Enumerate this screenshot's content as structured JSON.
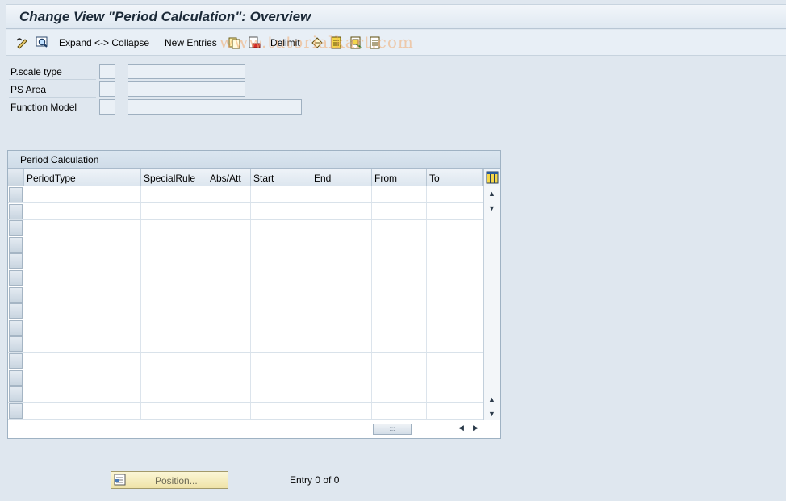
{
  "window": {
    "title": "Change View \"Period Calculation\": Overview"
  },
  "toolbar": {
    "display_change_icon": "glasses-pencil-icon",
    "other_view_icon": "magnifier-icon",
    "expand_collapse_label": "Expand <-> Collapse",
    "new_entries_label": "New Entries",
    "copy_icon": "copy-icon",
    "delete_icon": "delete-icon",
    "delimit_label": "Delimit",
    "undo_icon": "undo-icon",
    "select_all_icon": "select-all-icon",
    "select_block_icon": "select-block-icon",
    "deselect_all_icon": "deselect-all-icon",
    "watermark": "www.tutorialkart.com"
  },
  "fields": [
    {
      "label": "P.scale type",
      "value": ""
    },
    {
      "label": "PS Area",
      "value": ""
    },
    {
      "label": "Function Model",
      "value": ""
    }
  ],
  "table": {
    "title": "Period Calculation",
    "columns": [
      "PeriodType",
      "SpecialRule",
      "Abs/Att",
      "Start",
      "End",
      "From",
      "To"
    ],
    "rows": [],
    "settings_icon": "table-settings-icon"
  },
  "footer": {
    "position_button_label": "Position...",
    "entry_text": "Entry 0 of 0"
  },
  "colors": {
    "background": "#dfe7ef",
    "title_text": "#1c2a38",
    "position_button": "#f4ecc0"
  }
}
